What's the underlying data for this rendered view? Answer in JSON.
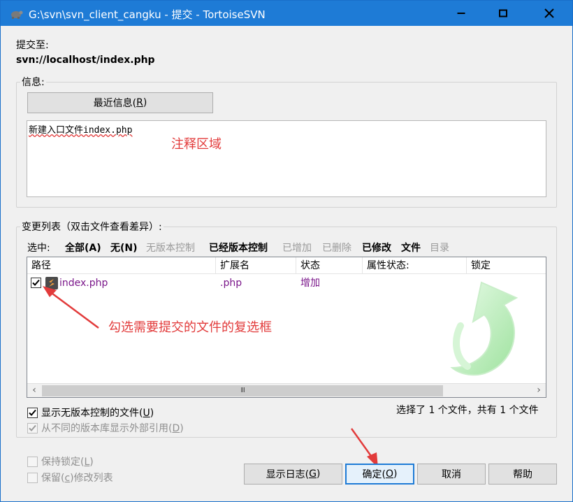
{
  "window": {
    "title": "G:\\svn\\svn_client_cangku - 提交 - TortoiseSVN",
    "minimize_icon": "minimize-icon",
    "maximize_icon": "maximize-icon",
    "close_icon": "close-icon"
  },
  "commit_to": {
    "label": "提交至:",
    "url": "svn://localhost/index.php"
  },
  "message": {
    "group_label": "信息:",
    "recent_button_text": "最近信息(",
    "recent_button_key": "R",
    "recent_button_suffix": ")",
    "text": "新建入口文件index.php",
    "annotation": "注释区域"
  },
  "changes": {
    "group_label": "变更列表（双击文件查看差异）:",
    "select_label": "选中:",
    "select_all": "全部(A)",
    "select_none": "无(N)",
    "unversioned": "无版本控制",
    "versioned": "已经版本控制",
    "added": "已增加",
    "deleted": "已删除",
    "modified": "已修改",
    "files": "文件",
    "dirs": "目录",
    "columns": [
      "路径",
      "扩展名",
      "状态",
      "属性状态:",
      "锁定"
    ],
    "rows": [
      {
        "checked": true,
        "path": "index.php",
        "ext": ".php",
        "status": "增加",
        "prop_status": "",
        "lock": ""
      }
    ],
    "checkbox_annotation": "勾选需要提交的文件的复选框",
    "summary": "选择了 1 个文件，共有 1 个文件",
    "show_unversioned_text": "显示无版本控制的文件(",
    "show_unversioned_key": "U",
    "show_unversioned_suffix": ")",
    "show_unversioned_checked": true,
    "show_externals_text": "从不同的版本库显示外部引用(",
    "show_externals_key": "D",
    "show_externals_suffix": ")",
    "show_externals_checked": true
  },
  "options": {
    "keep_locks_text": "保持锁定(",
    "keep_locks_key": "L",
    "keep_locks_suffix": ")",
    "keep_changelist_text": "保留(",
    "keep_changelist_key": "c",
    "keep_changelist_suffix": ")修改列表"
  },
  "buttons": {
    "show_log_text": "显示日志(",
    "show_log_key": "G",
    "show_log_suffix": ")",
    "ok_text": "确定(",
    "ok_key": "O",
    "ok_suffix": ")",
    "cancel": "取消",
    "help": "帮助"
  },
  "colors": {
    "titlebar": "#1e7bd6",
    "close_hover": "#e81123",
    "annotation_red": "#e23b3b",
    "file_purple": "#7a168a",
    "arrow_green": "#b9f0b9"
  }
}
